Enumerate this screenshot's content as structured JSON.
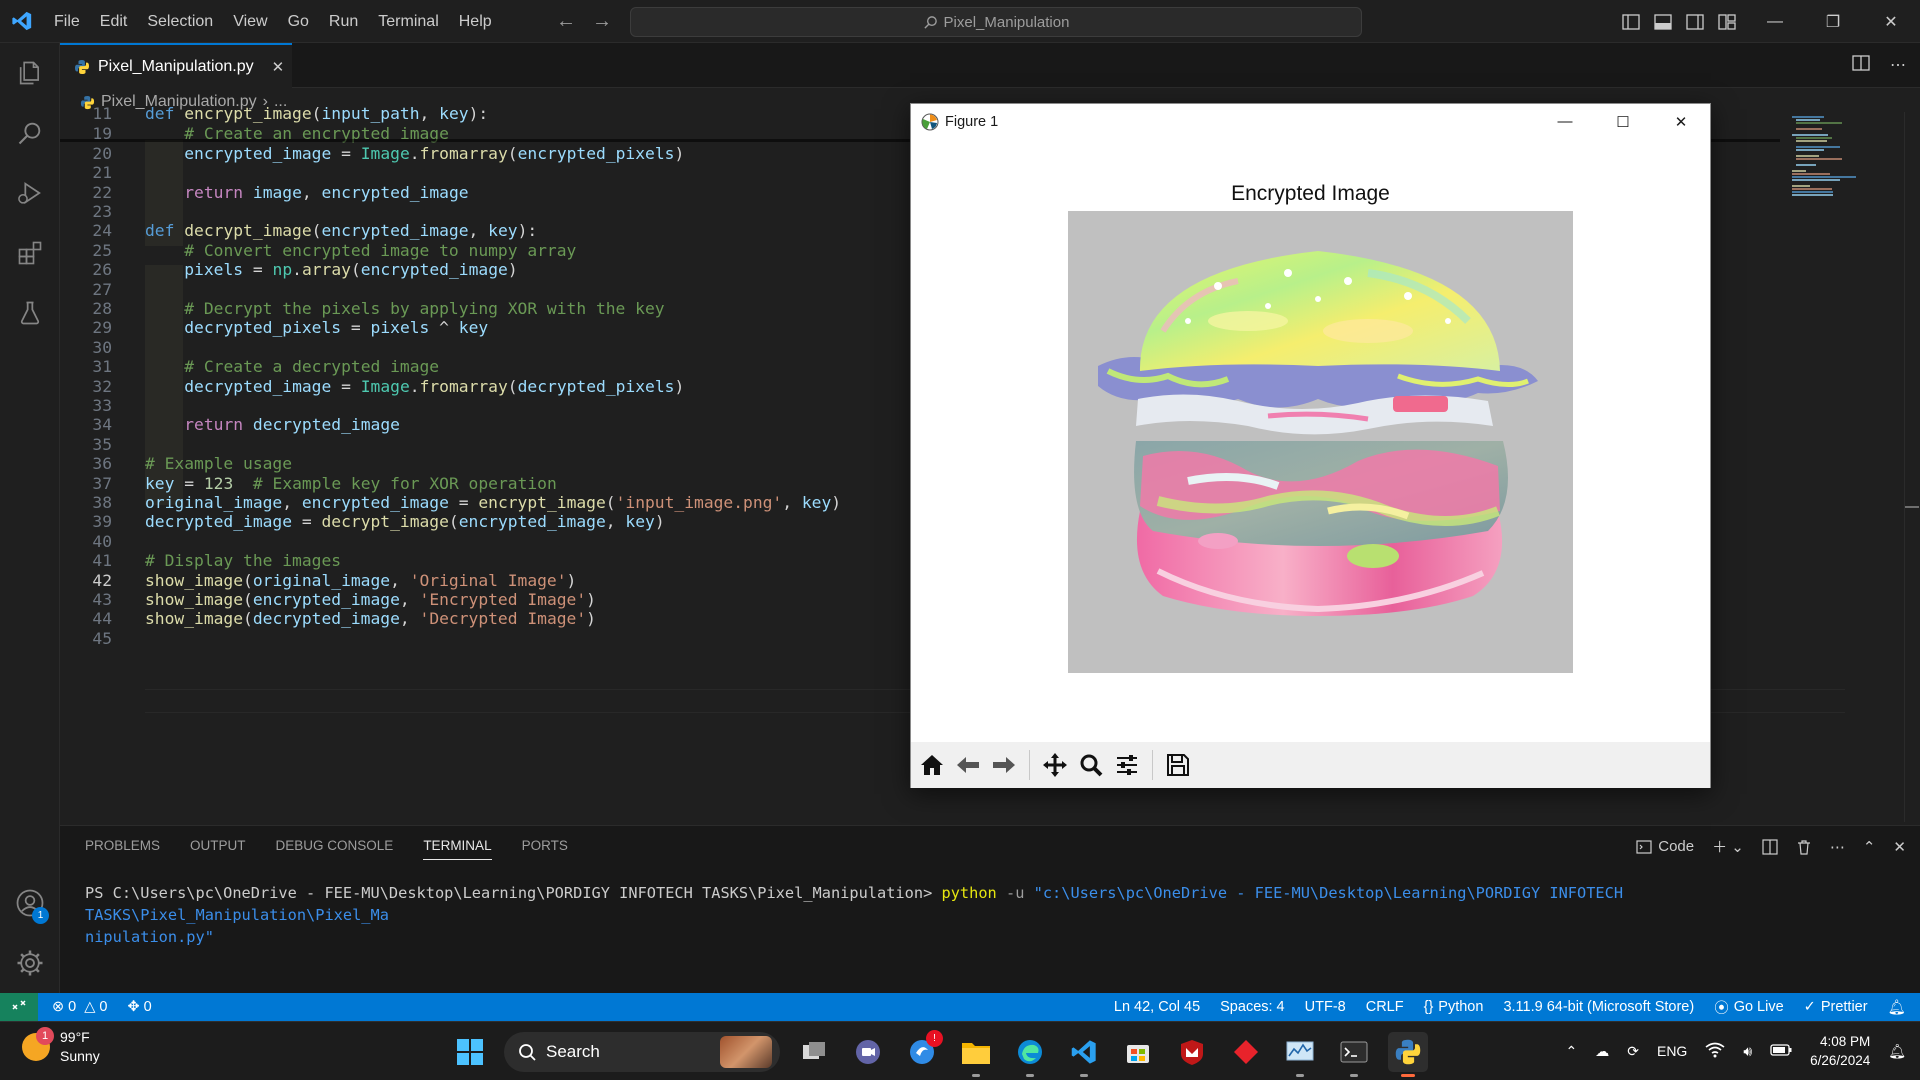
{
  "titlebar": {
    "menu": [
      "File",
      "Edit",
      "Selection",
      "View",
      "Go",
      "Run",
      "Terminal",
      "Help"
    ],
    "search": "Pixel_Manipulation"
  },
  "tab": {
    "filename": "Pixel_Manipulation.py"
  },
  "breadcrumb": {
    "file": "Pixel_Manipulation.py",
    "rest": "..."
  },
  "editor": {
    "lines": [
      {
        "n": "11",
        "code": "def encrypt_image(input_path, key):"
      },
      {
        "n": "19",
        "code": "    # Create an encrypted image"
      },
      {
        "n": "20",
        "code": "    encrypted_image = Image.fromarray(encrypted_pixels)"
      },
      {
        "n": "21",
        "code": ""
      },
      {
        "n": "22",
        "code": "    return image, encrypted_image"
      },
      {
        "n": "23",
        "code": ""
      },
      {
        "n": "24",
        "code": "def decrypt_image(encrypted_image, key):"
      },
      {
        "n": "25",
        "code": "    # Convert encrypted image to numpy array"
      },
      {
        "n": "26",
        "code": "    pixels = np.array(encrypted_image)"
      },
      {
        "n": "27",
        "code": ""
      },
      {
        "n": "28",
        "code": "    # Decrypt the pixels by applying XOR with the key"
      },
      {
        "n": "29",
        "code": "    decrypted_pixels = pixels ^ key"
      },
      {
        "n": "30",
        "code": ""
      },
      {
        "n": "31",
        "code": "    # Create a decrypted image"
      },
      {
        "n": "32",
        "code": "    decrypted_image = Image.fromarray(decrypted_pixels)"
      },
      {
        "n": "33",
        "code": ""
      },
      {
        "n": "34",
        "code": "    return decrypted_image"
      },
      {
        "n": "35",
        "code": ""
      },
      {
        "n": "36",
        "code": "# Example usage"
      },
      {
        "n": "37",
        "code": "key = 123  # Example key for XOR operation"
      },
      {
        "n": "38",
        "code": "original_image, encrypted_image = encrypt_image('input_image.png', key)"
      },
      {
        "n": "39",
        "code": "decrypted_image = decrypt_image(encrypted_image, key)"
      },
      {
        "n": "40",
        "code": ""
      },
      {
        "n": "41",
        "code": "# Display the images"
      },
      {
        "n": "42",
        "code": "show_image(original_image, 'Original Image')"
      },
      {
        "n": "43",
        "code": "show_image(encrypted_image, 'Encrypted Image')"
      },
      {
        "n": "44",
        "code": "show_image(decrypted_image, 'Decrypted Image')"
      },
      {
        "n": "45",
        "code": ""
      }
    ],
    "current_line": "42"
  },
  "panel": {
    "tabs": [
      "PROBLEMS",
      "OUTPUT",
      "DEBUG CONSOLE",
      "TERMINAL",
      "PORTS"
    ],
    "active_tab": "TERMINAL",
    "shell_label": "Code",
    "prompt": "PS C:\\Users\\pc\\OneDrive - FEE-MU\\Desktop\\Learning\\PORDIGY INFOTECH TASKS\\Pixel_Manipulation>",
    "command": "python",
    "flag": "-u",
    "path_part1": "\"c:\\Users\\pc\\OneDrive - FEE-MU\\Desktop\\Learning\\PORDIGY INFOTECH TASKS\\Pixel_Manipulation\\Pixel_Ma",
    "path_part2": "nipulation.py\""
  },
  "statusbar": {
    "errors": "0",
    "warnings": "0",
    "ports": "0",
    "position": "Ln 42, Col 45",
    "spaces": "Spaces: 4",
    "encoding": "UTF-8",
    "eol": "CRLF",
    "language": "Python",
    "interpreter": "3.11.9 64-bit (Microsoft Store)",
    "golive": "Go Live",
    "prettier": "Prettier"
  },
  "figure": {
    "window_title": "Figure 1",
    "plot_title": "Encrypted Image"
  },
  "taskbar": {
    "temp": "99°F",
    "condition": "Sunny",
    "weather_badge": "1",
    "search": "Search",
    "lang": "ENG",
    "time": "4:08 PM",
    "date": "6/26/2024"
  },
  "activity": {
    "accounts_badge": "1"
  },
  "colors": {
    "accent": "#0078d4",
    "statusbar": "#0078d4",
    "remote": "#16825d"
  }
}
